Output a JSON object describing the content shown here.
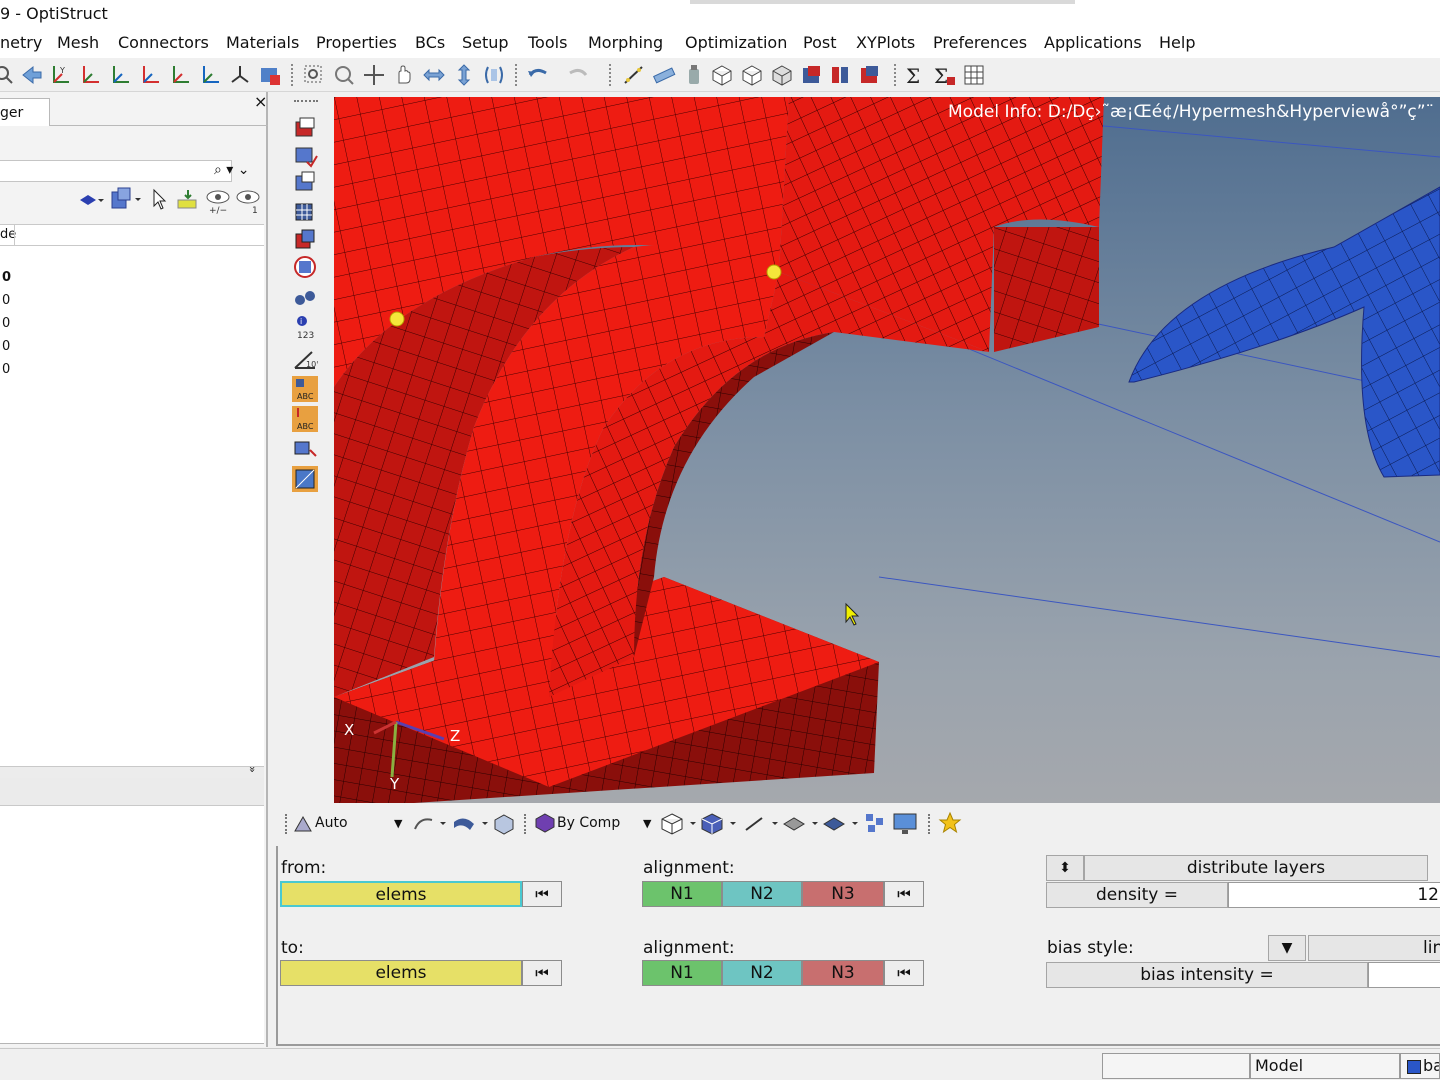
{
  "window": {
    "title": "9 - OptiStruct"
  },
  "menu": [
    "netry",
    "Mesh",
    "Connectors",
    "Materials",
    "Properties",
    "BCs",
    "Setup",
    "Tools",
    "Morphing",
    "Optimization",
    "Post",
    "XYPlots",
    "Preferences",
    "Applications",
    "Help"
  ],
  "left_panel": {
    "tab_label": "ger",
    "close_symbol": "×",
    "column_header": "de",
    "rows": [
      "0",
      "0",
      "0",
      "0",
      "0"
    ],
    "collapse_symbol": "»"
  },
  "viewport": {
    "model_info": "Model Info: D:/Dç›˜æ¡Œé¢/Hypermesh&Hyperviewå°”ç”¨",
    "axes": {
      "x": "X",
      "y": "Y",
      "z": "Z"
    },
    "colors": {
      "mesh_red": "#ee1a10",
      "mesh_blue": "#2a56c8",
      "node": "#f5e63a"
    }
  },
  "vis_toolbar": {
    "display_mode": "Auto",
    "color_mode": "By Comp"
  },
  "panel": {
    "from_label": "from:",
    "to_label": "to:",
    "alignment_label": "alignment:",
    "from_selector": "elems",
    "to_selector": "elems",
    "node_buttons": [
      "N1",
      "N2",
      "N3"
    ],
    "skip_symbol": "⏮",
    "distribute": "distribute layers",
    "density_label": "density =",
    "density_value": "12",
    "bias_style_label": "bias style:",
    "bias_style_value": "linear",
    "bias_intensity_label": "bias intensity =",
    "bias_intensity_value": ""
  },
  "status": {
    "field1": "",
    "field2": "Model",
    "field3": "ba"
  }
}
